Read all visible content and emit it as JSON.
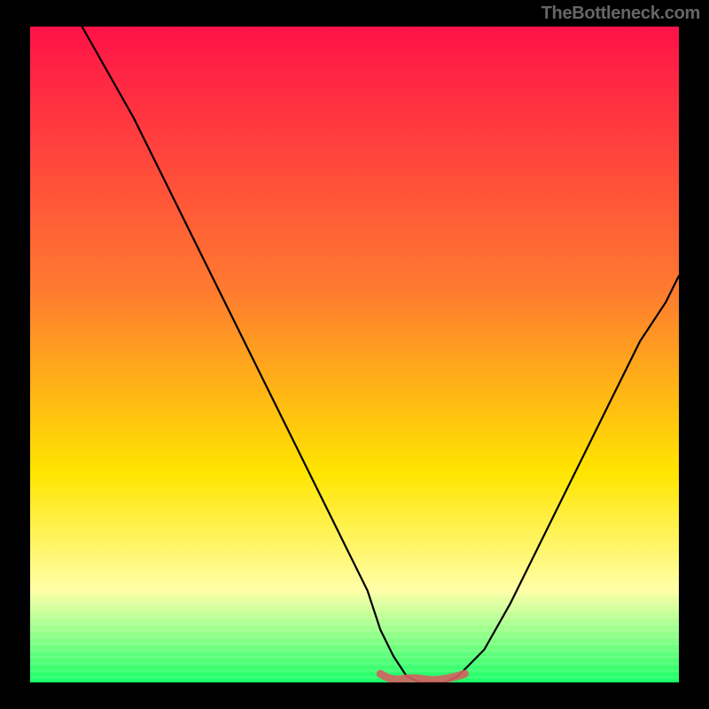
{
  "watermark": "TheBottleneck.com",
  "colors": {
    "background": "#000000",
    "gradient_top": "#ff1248",
    "gradient_mid": "#ffa500",
    "gradient_yellow": "#ffe500",
    "gradient_pale": "#ffffa8",
    "gradient_bottom": "#18ff66",
    "curve": "#000000",
    "bottom_accent": "#d46060"
  },
  "chart_data": {
    "type": "line",
    "title": "",
    "xlabel": "",
    "ylabel": "",
    "xlim": [
      0,
      100
    ],
    "ylim": [
      0,
      100
    ],
    "x": [
      8,
      12,
      16,
      20,
      24,
      28,
      32,
      36,
      40,
      44,
      48,
      52,
      54,
      56,
      58,
      60,
      62,
      64,
      66,
      70,
      74,
      78,
      82,
      86,
      90,
      94,
      98,
      100
    ],
    "values": [
      100,
      93,
      86,
      78,
      70,
      62,
      54,
      46,
      38,
      30,
      22,
      14,
      8,
      4,
      1,
      0,
      0,
      0,
      1,
      5,
      12,
      20,
      28,
      36,
      44,
      52,
      58,
      62
    ],
    "annotations": [
      {
        "label": "bottom-accent-segment",
        "x_start": 54,
        "x_end": 67,
        "y": 0.5
      }
    ],
    "gradient_bands_pct_from_top": [
      {
        "color": "#ff1248",
        "stop": 0
      },
      {
        "color": "#ff7a30",
        "stop": 40
      },
      {
        "color": "#ffe500",
        "stop": 68
      },
      {
        "color": "#ffffa8",
        "stop": 86
      },
      {
        "color": "#18ff66",
        "stop": 100
      }
    ]
  }
}
